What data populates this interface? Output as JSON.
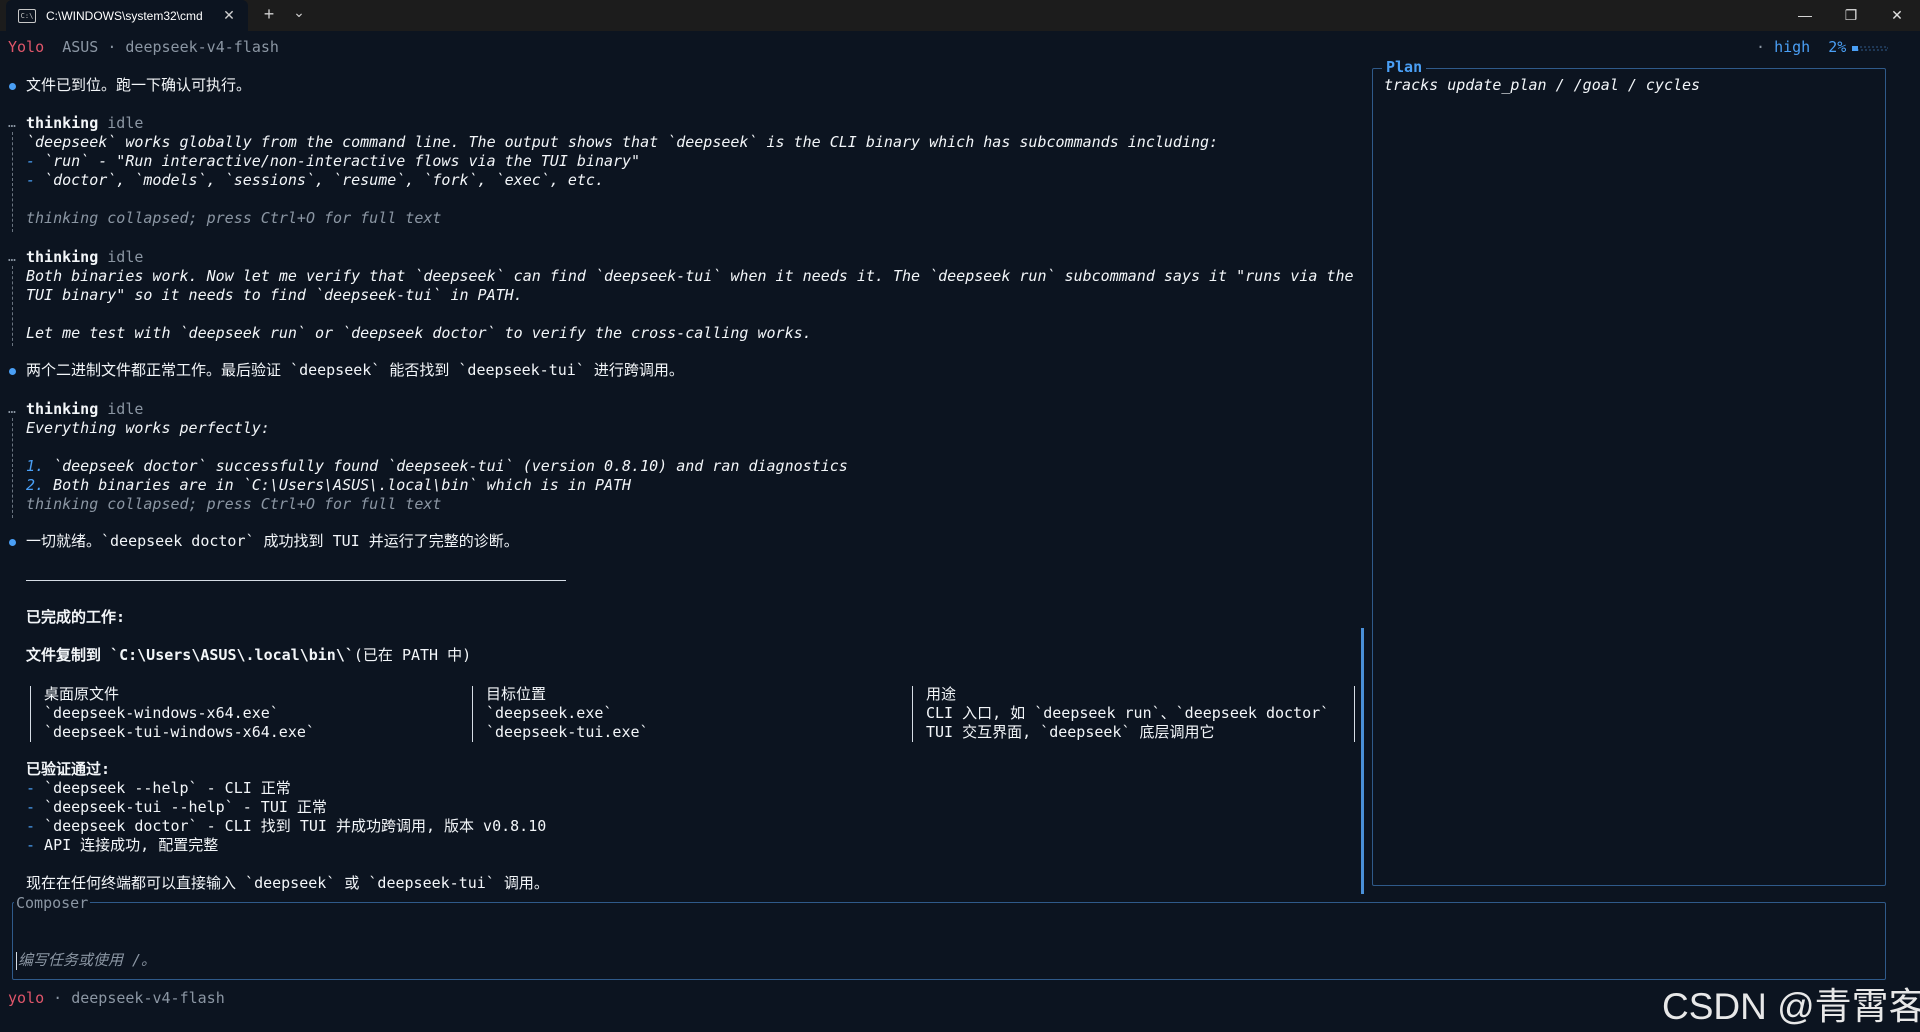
{
  "window": {
    "tab_title": "C:\\WINDOWS\\system32\\cmd",
    "tab_icon_text": "C:\\",
    "close_glyph": "✕",
    "new_tab_glyph": "+",
    "dropdown_glyph": "⌄",
    "minimize_glyph": "—",
    "restore_glyph": "❐",
    "win_close_glyph": "✕"
  },
  "header": {
    "mode": "Yolo",
    "host": "ASUS",
    "sep": "·",
    "model": "deepseek-v4-flash",
    "effort_dot": "·",
    "effort": "high",
    "usage": "2%",
    "usage_fraction": 0.02
  },
  "transcript": {
    "msg1": "文件已到位。跑一下确认可执行。",
    "t1": {
      "label": "thinking",
      "state": "idle",
      "l1": "`deepseek` works globally from the command line. The output shows that `deepseek` is the CLI binary which has subcommands including:",
      "l2_dash": "-",
      "l2": " `run` - \"Run interactive/non-interactive flows via the TUI binary\"",
      "l3_dash": "-",
      "l3": " `doctor`, `models`, `sessions`, `resume`, `fork`, `exec`, etc.",
      "collapsed": "thinking collapsed; press Ctrl+O for full text"
    },
    "t2": {
      "label": "thinking",
      "state": "idle",
      "l1": "Both binaries work. Now let me verify that `deepseek` can find `deepseek-tui` when it needs it. The `deepseek run` subcommand says it \"runs via the",
      "l2": "TUI binary\" so it needs to find `deepseek-tui` in PATH.",
      "l3": "Let me test with `deepseek run` or `deepseek doctor` to verify the cross-calling works."
    },
    "msg2": "两个二进制文件都正常工作。最后验证 `deepseek` 能否找到 `deepseek-tui` 进行跨调用。",
    "t3": {
      "label": "thinking",
      "state": "idle",
      "l1": "Everything works perfectly:",
      "n1": "1.",
      "l2": " `deepseek doctor` successfully found `deepseek-tui` (version 0.8.10) and ran diagnostics",
      "n2": "2.",
      "l3": " Both binaries are in `C:\\Users\\ASUS\\.local\\bin` which is in PATH",
      "collapsed": "thinking collapsed; press Ctrl+O for full text"
    },
    "msg3": "一切就绪。`deepseek doctor` 成功找到 TUI 并运行了完整的诊断。",
    "done_heading": "已完成的工作:",
    "copied_prefix": "文件复制到 ",
    "copied_path": "`C:\\Users\\ASUS\\.local\\bin\\`",
    "copied_suffix": "(已在 PATH 中)",
    "table": {
      "headers": [
        "桌面原文件",
        "目标位置",
        "用途"
      ],
      "rows": [
        [
          "`deepseek-windows-x64.exe`",
          "`deepseek.exe`",
          "CLI 入口, 如 `deepseek run`、`deepseek doctor`"
        ],
        [
          "`deepseek-tui-windows-x64.exe`",
          "`deepseek-tui.exe`",
          "TUI 交互界面, `deepseek` 底层调用它"
        ]
      ]
    },
    "verified_heading": "已验证通过:",
    "verified_dash": "-",
    "verified": [
      " `deepseek --help` - CLI 正常",
      " `deepseek-tui --help` - TUI 正常",
      " `deepseek doctor` - CLI 找到 TUI 并成功跨调用, 版本 v0.8.10",
      " API 连接成功, 配置完整"
    ],
    "final": "现在在任何终端都可以直接输入 `deepseek` 或 `deepseek-tui` 调用。"
  },
  "plan": {
    "title": "Plan",
    "body": "tracks update_plan / /goal / cycles"
  },
  "composer": {
    "label": "Composer",
    "placeholder": "编写任务或使用 /。"
  },
  "footer": {
    "mode": "yolo",
    "sep": "·",
    "model": "deepseek-v4-flash"
  },
  "watermark": "CSDN @青霄客",
  "colors": {
    "background": "#0c1420",
    "accent": "#4a9ff5",
    "mode": "#e0566a",
    "border": "#2f5a8a"
  }
}
